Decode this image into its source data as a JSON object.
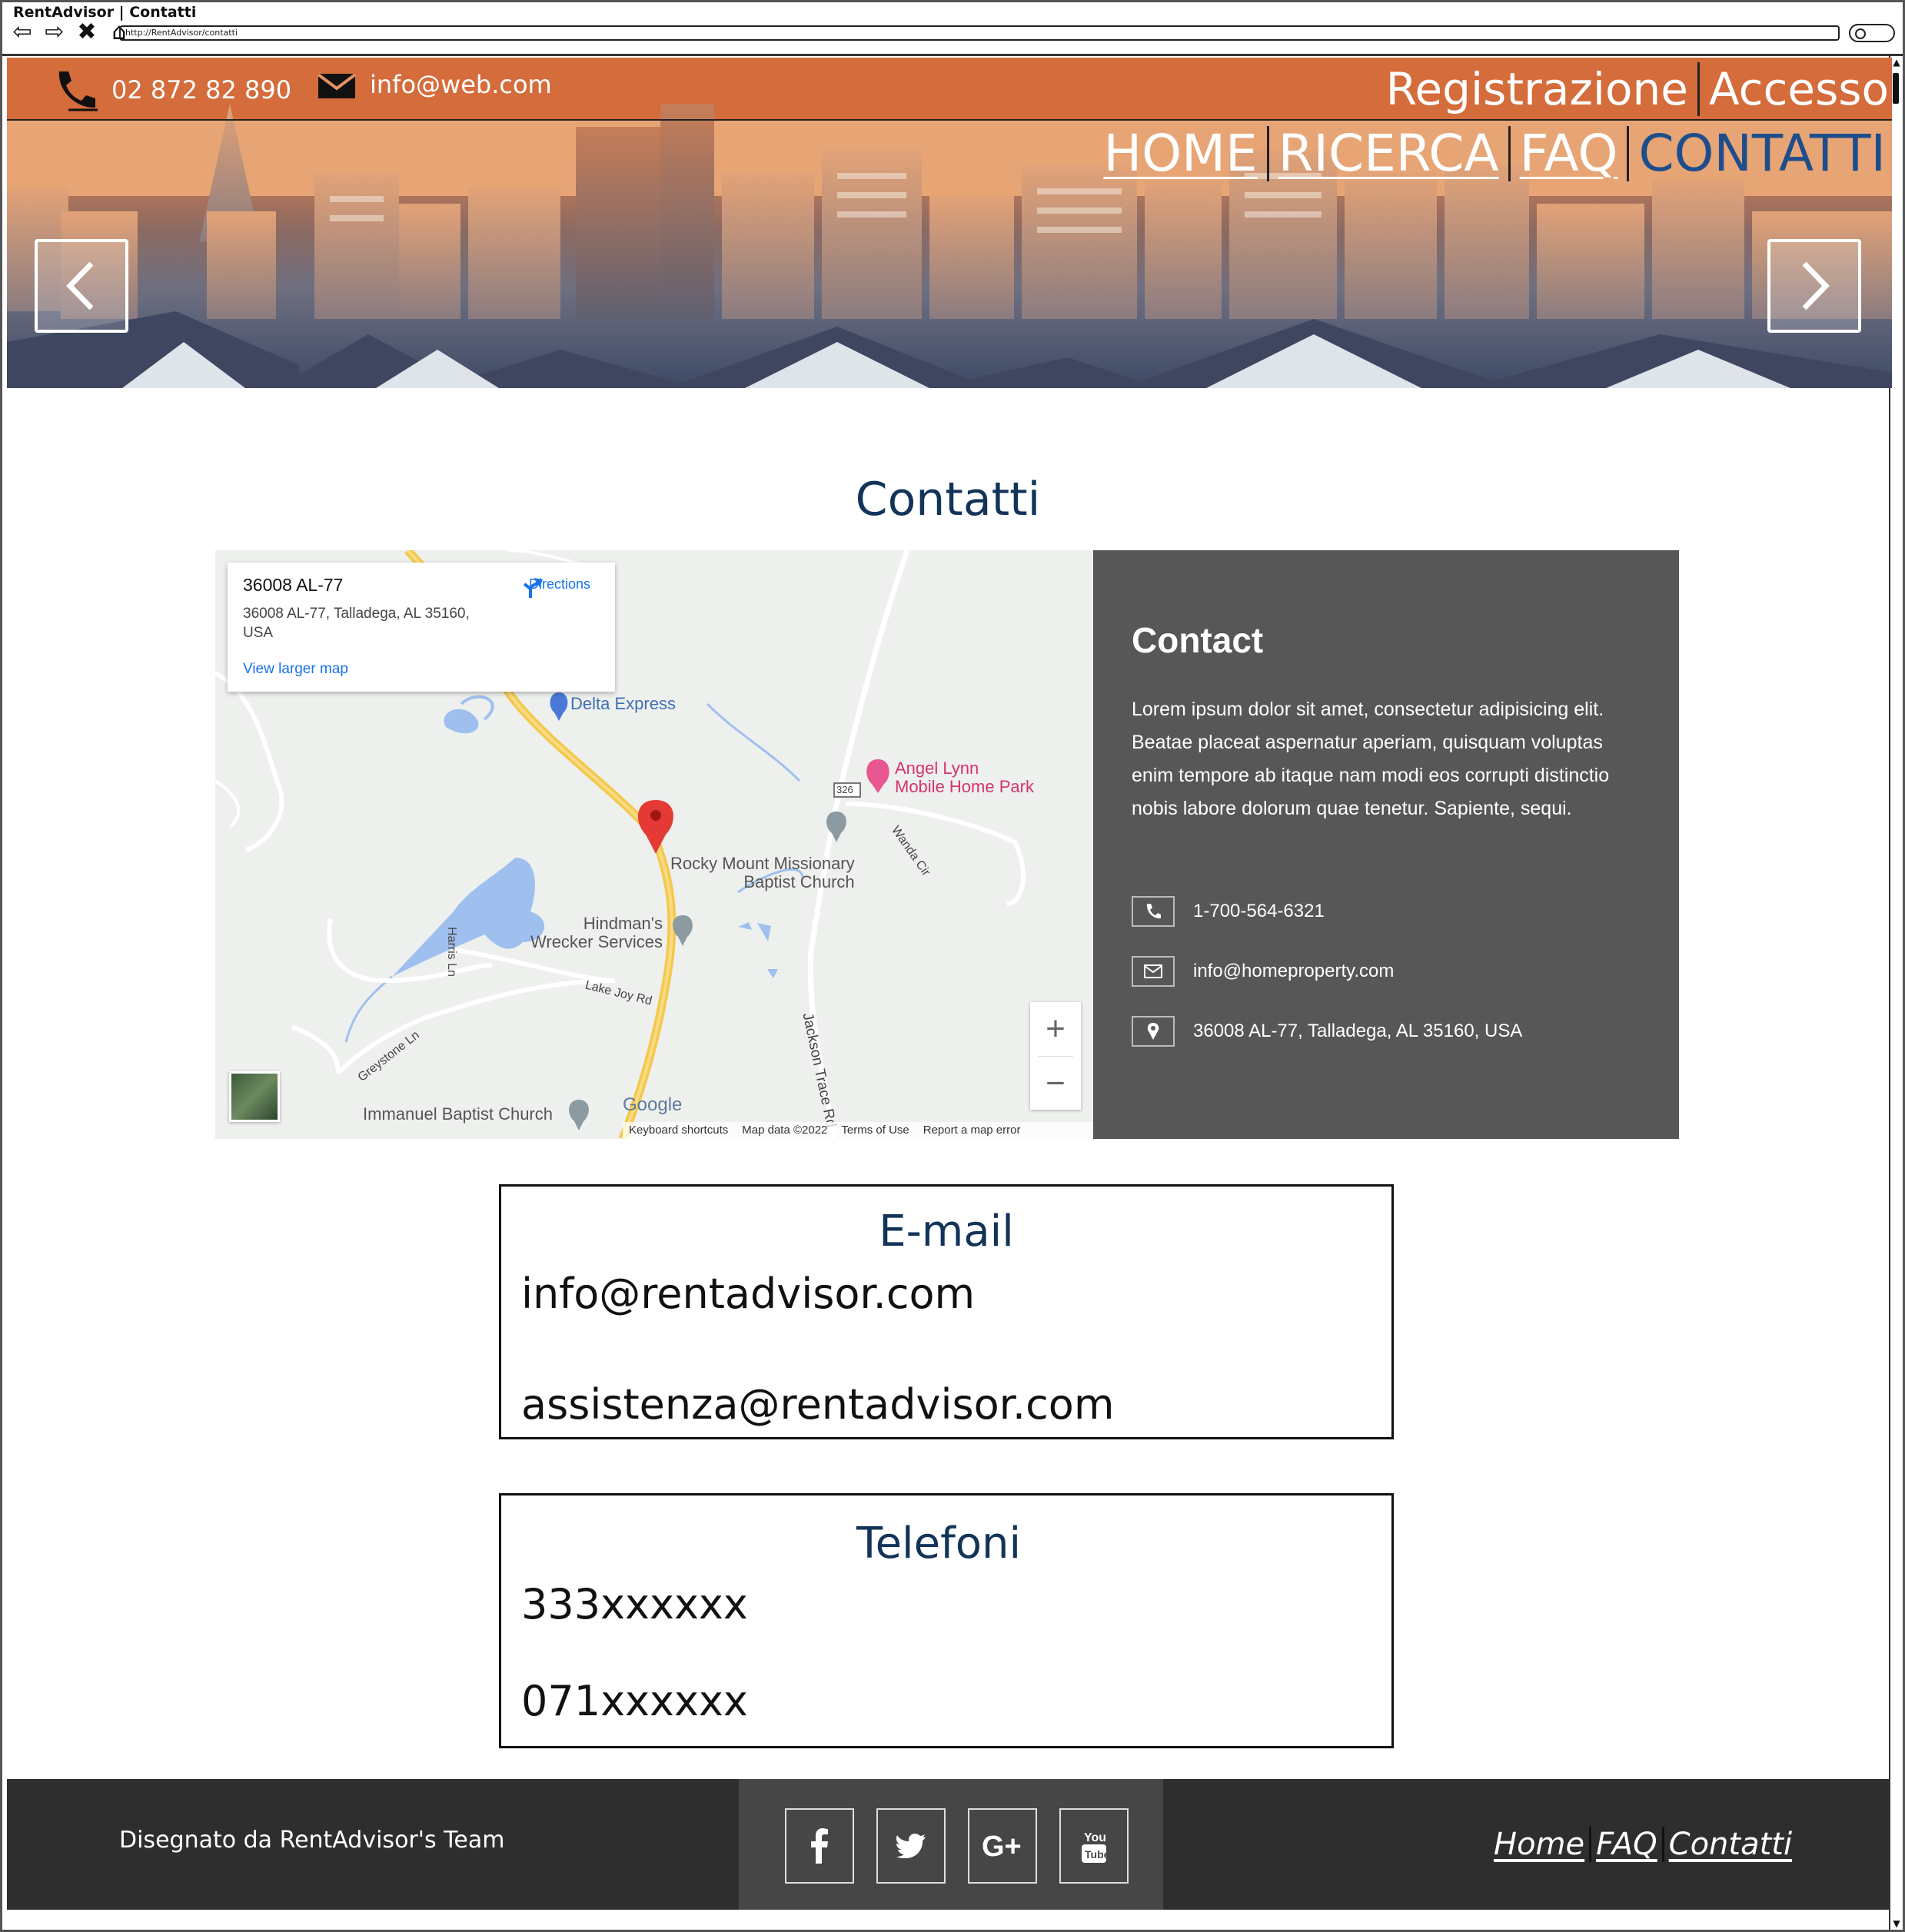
{
  "window": {
    "title": "RentAdvisor | Contatti",
    "url": "http://RentAdvisor/contatti",
    "nav_buttons": [
      "⇦",
      "⇨",
      "✖",
      "⌂"
    ]
  },
  "header": {
    "phone": "02 872 82 890",
    "email": "info@web.com",
    "auth": {
      "register": "Registrazione",
      "login": "Accesso"
    },
    "nav": [
      {
        "label": "HOME",
        "active": false
      },
      {
        "label": "RICERCA",
        "active": false
      },
      {
        "label": "FAQ",
        "active": false
      },
      {
        "label": "CONTATTI",
        "active": true
      }
    ],
    "active_color": "#1e4d8c"
  },
  "page": {
    "title": "Contatti"
  },
  "map": {
    "place_title": "36008 AL-77",
    "place_address": "36008 AL-77, Talladega, AL 35160, USA",
    "directions_label": "Directions",
    "view_larger": "View larger map",
    "labels": {
      "delta": "Delta Express",
      "angel": "Angel Lynn\nMobile Home Park",
      "rocky": "Rocky Mount Missionary\nBaptist Church",
      "hindman": "Hindman's\nWrecker Services",
      "immanuel": "Immanuel Baptist Church",
      "harris": "Harris Ln",
      "lakejoy": "Lake Joy Rd",
      "greystone": "Greystone Ln",
      "jackson": "Jackson Trace Rd",
      "wanda": "Wanda Cir",
      "route": "326"
    },
    "zoom_in": "+",
    "zoom_out": "−",
    "google": "Google",
    "footer_links": [
      "Keyboard shortcuts",
      "Map data ©2022",
      "Terms of Use",
      "Report a map error"
    ]
  },
  "contact_panel": {
    "title": "Contact",
    "text": "Lorem ipsum dolor sit amet, consectetur adipisicing elit. Beatae placeat aspernatur aperiam, quisquam voluptas enim tempore ab itaque nam modi eos corrupti distinctio nobis labore dolorum quae tenetur. Sapiente, sequi.",
    "phone": "1-700-564-6321",
    "email": "info@homeproperty.com",
    "address": "36008 AL-77, Talladega, AL 35160, USA"
  },
  "email_box": {
    "title": "E-mail",
    "lines": [
      "info@rentadvisor.com",
      "assistenza@rentadvisor.com"
    ]
  },
  "phone_box": {
    "title": "Telefoni",
    "lines": [
      "333xxxxxx",
      "071xxxxxx"
    ]
  },
  "footer": {
    "credit": "Disegnato da RentAdvisor's Team",
    "social": [
      "facebook-icon",
      "twitter-icon",
      "google-plus-icon",
      "youtube-icon"
    ],
    "links": [
      "Home",
      "FAQ",
      "Contatti"
    ]
  }
}
